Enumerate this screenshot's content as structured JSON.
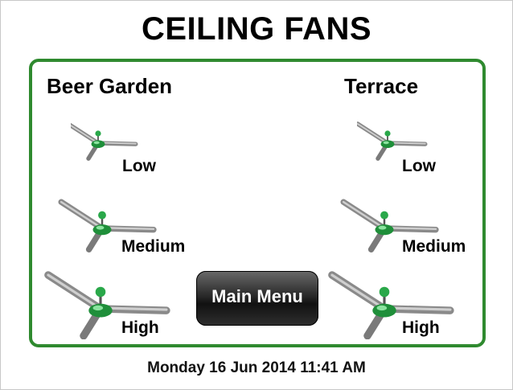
{
  "title": "CEILING FANS",
  "zones": [
    {
      "name": "Beer Garden",
      "speeds": [
        "Low",
        "Medium",
        "High"
      ]
    },
    {
      "name": "Terrace",
      "speeds": [
        "Low",
        "Medium",
        "High"
      ]
    }
  ],
  "main_menu_label": "Main Menu",
  "datetime": "Monday 16 Jun 2014 11:41 AM",
  "colors": {
    "panel_border": "#2f8a2f",
    "fan_hub": "#2aa84a",
    "fan_blade": "#8a8a8a"
  },
  "icons": {
    "fan": "ceiling-fan-icon"
  }
}
